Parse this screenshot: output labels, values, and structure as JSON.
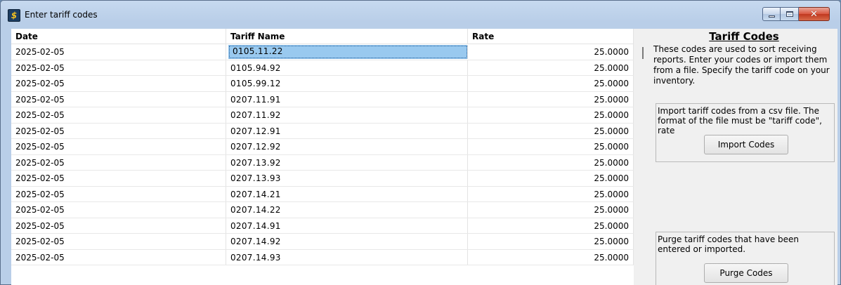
{
  "window": {
    "title": "Enter tariff codes",
    "close_glyph": "✕"
  },
  "grid": {
    "columns": [
      "Date",
      "Tariff Name",
      "Rate"
    ],
    "rows": [
      {
        "date": "2025-02-05",
        "name": "0105.11.22",
        "rate": "25.0000"
      },
      {
        "date": "2025-02-05",
        "name": "0105.94.92",
        "rate": "25.0000"
      },
      {
        "date": "2025-02-05",
        "name": "0105.99.12",
        "rate": "25.0000"
      },
      {
        "date": "2025-02-05",
        "name": "0207.11.91",
        "rate": "25.0000"
      },
      {
        "date": "2025-02-05",
        "name": "0207.11.92",
        "rate": "25.0000"
      },
      {
        "date": "2025-02-05",
        "name": "0207.12.91",
        "rate": "25.0000"
      },
      {
        "date": "2025-02-05",
        "name": "0207.12.92",
        "rate": "25.0000"
      },
      {
        "date": "2025-02-05",
        "name": "0207.13.92",
        "rate": "25.0000"
      },
      {
        "date": "2025-02-05",
        "name": "0207.13.93",
        "rate": "25.0000"
      },
      {
        "date": "2025-02-05",
        "name": "0207.14.21",
        "rate": "25.0000"
      },
      {
        "date": "2025-02-05",
        "name": "0207.14.22",
        "rate": "25.0000"
      },
      {
        "date": "2025-02-05",
        "name": "0207.14.91",
        "rate": "25.0000"
      },
      {
        "date": "2025-02-05",
        "name": "0207.14.92",
        "rate": "25.0000"
      },
      {
        "date": "2025-02-05",
        "name": "0207.14.93",
        "rate": "25.0000"
      }
    ]
  },
  "panel": {
    "title": "Tariff Codes",
    "description": "These codes are used to sort receiving reports.   Enter your codes or import them from a file.  Specify the tariff code on your inventory.",
    "import": {
      "text": "Import tariff codes from a csv file.  The format of the file must be \"tariff code\", rate",
      "button": "Import Codes"
    },
    "purge": {
      "text": "Purge tariff codes that have been entered or imported.",
      "button": "Purge Codes"
    }
  }
}
